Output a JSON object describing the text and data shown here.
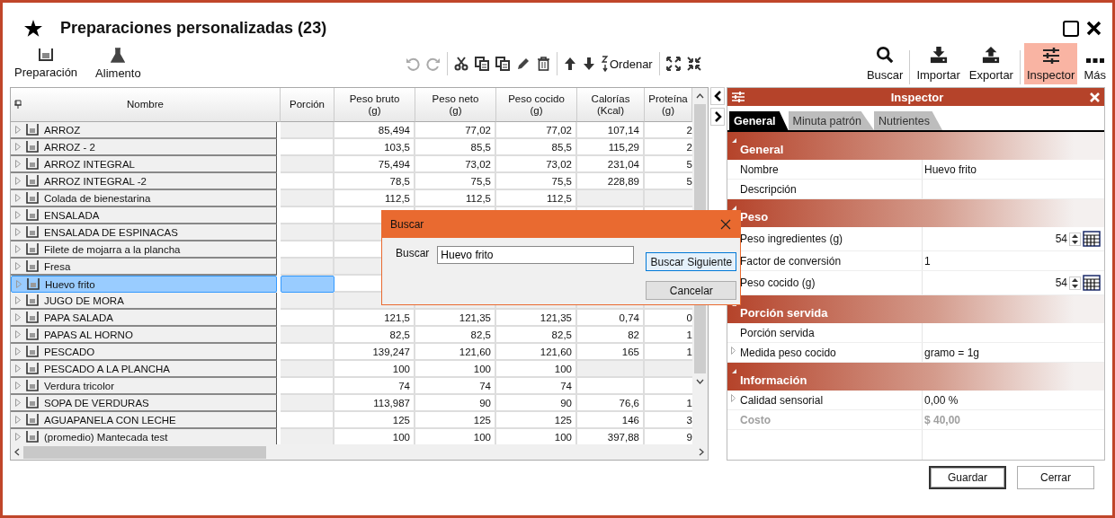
{
  "window": {
    "title": "Preparaciones personalizadas (23)"
  },
  "left_tools": [
    {
      "kind": "bowl",
      "label": "Preparación"
    },
    {
      "kind": "flask",
      "label": "Alimento"
    }
  ],
  "edit_tools": [
    {
      "kind": "undo",
      "disabled": true
    },
    {
      "kind": "redo",
      "disabled": true
    },
    {
      "kind": "sep"
    },
    {
      "kind": "cut"
    },
    {
      "kind": "copy"
    },
    {
      "kind": "paste"
    },
    {
      "kind": "edit"
    },
    {
      "kind": "delete"
    },
    {
      "kind": "sep"
    },
    {
      "kind": "up"
    },
    {
      "kind": "down"
    },
    {
      "kind": "sort",
      "label": "Ordenar"
    },
    {
      "kind": "sep"
    },
    {
      "kind": "expand"
    },
    {
      "kind": "collapse"
    }
  ],
  "right_tools": [
    {
      "kind": "search",
      "label": "Buscar",
      "selected": false
    },
    {
      "kind": "import",
      "label": "Importar",
      "selected": false
    },
    {
      "kind": "export",
      "label": "Exportar",
      "selected": false
    },
    {
      "kind": "inspector",
      "label": "Inspector",
      "selected": true
    },
    {
      "kind": "more",
      "label": "Más",
      "selected": false
    }
  ],
  "table": {
    "columns": [
      "Nombre",
      "Porción",
      "Peso bruto\n(g)",
      "Peso neto\n(g)",
      "Peso cocido\n(g)",
      "Calorías\n(Kcal)",
      "Proteína\n(g)"
    ],
    "rows": [
      {
        "selected": false,
        "cells": [
          "ARROZ",
          null,
          "85,494",
          "77,02",
          "77,02",
          "107,14",
          "2"
        ]
      },
      {
        "selected": false,
        "cells": [
          "ARROZ - 2",
          null,
          "103,5",
          "85,5",
          "85,5",
          "115,29",
          "2"
        ]
      },
      {
        "selected": false,
        "cells": [
          "ARROZ INTEGRAL",
          null,
          "75,494",
          "73,02",
          "73,02",
          "231,04",
          "5"
        ]
      },
      {
        "selected": false,
        "cells": [
          "ARROZ INTEGRAL -2",
          null,
          "78,5",
          "75,5",
          "75,5",
          "228,89",
          "5"
        ]
      },
      {
        "selected": false,
        "cells": [
          "Colada de bienestarina",
          null,
          "112,5",
          "112,5",
          "112,5",
          null,
          null
        ]
      },
      {
        "selected": false,
        "cells": [
          "ENSALADA",
          null,
          null,
          null,
          null,
          null,
          null
        ]
      },
      {
        "selected": false,
        "cells": [
          "ENSALADA DE ESPINACAS",
          null,
          null,
          null,
          null,
          null,
          null
        ]
      },
      {
        "selected": false,
        "cells": [
          "Filete de mojarra a la plancha",
          null,
          null,
          null,
          null,
          null,
          null
        ]
      },
      {
        "selected": false,
        "cells": [
          "Fresa",
          null,
          null,
          null,
          null,
          null,
          null
        ]
      },
      {
        "selected": true,
        "cells": [
          "Huevo frito",
          null,
          null,
          null,
          null,
          null,
          null
        ]
      },
      {
        "selected": false,
        "cells": [
          "JUGO DE MORA",
          null,
          null,
          null,
          null,
          null,
          null
        ]
      },
      {
        "selected": false,
        "cells": [
          "PAPA SALADA",
          null,
          "121,5",
          "121,35",
          "121,35",
          "0,74",
          "0"
        ]
      },
      {
        "selected": false,
        "cells": [
          "PAPAS AL HORNO",
          null,
          "82,5",
          "82,5",
          "82,5",
          "82",
          "1"
        ]
      },
      {
        "selected": false,
        "cells": [
          "PESCADO",
          null,
          "139,247",
          "121,60",
          "121,60",
          "165",
          "1"
        ]
      },
      {
        "selected": false,
        "cells": [
          "PESCADO A LA PLANCHA",
          null,
          "100",
          "100",
          "100",
          null,
          null
        ]
      },
      {
        "selected": false,
        "cells": [
          "Verdura tricolor",
          null,
          "74",
          "74",
          "74",
          null,
          null
        ]
      },
      {
        "selected": false,
        "cells": [
          "SOPA DE VERDURAS",
          null,
          "113,987",
          "90",
          "90",
          "76,6",
          "1"
        ]
      },
      {
        "selected": false,
        "cells": [
          "AGUAPANELA CON LECHE",
          null,
          "125",
          "125",
          "125",
          "146",
          "3"
        ]
      },
      {
        "selected": false,
        "cells": [
          "(promedio) Mantecada test",
          null,
          "100",
          "100",
          "100",
          "397,88",
          "9"
        ]
      }
    ]
  },
  "dialog": {
    "title": "Buscar",
    "label": "Buscar",
    "value": "Huevo frito",
    "buttons": [
      {
        "label": "Buscar Siguiente",
        "default": true
      },
      {
        "label": "Cancelar",
        "default": false
      }
    ]
  },
  "inspector": {
    "title": "Inspector",
    "tabs": [
      {
        "label": "General",
        "selected": true
      },
      {
        "label": "Minuta patrón",
        "selected": false
      },
      {
        "label": "Nutrientes",
        "selected": false
      }
    ],
    "categories": [
      {
        "title": "General",
        "properties": [
          {
            "kind": "text",
            "label": "Nombre",
            "value": "Huevo frito",
            "expandable": false,
            "disabled": false
          },
          {
            "kind": "text",
            "label": "Descripción",
            "expandable": false,
            "disabled": false
          }
        ]
      },
      {
        "title": "Peso",
        "properties": [
          {
            "kind": "spin",
            "label": "Peso ingredientes (g)",
            "value": "54",
            "disabled": false
          },
          {
            "kind": "text",
            "label": "Factor de conversión",
            "value": "1",
            "disabled": false
          },
          {
            "kind": "spin",
            "label": "Peso cocido (g)",
            "value": "54",
            "disabled": false
          }
        ]
      },
      {
        "title": "Porción servida",
        "properties": [
          {
            "kind": "text",
            "label": "Porción servida",
            "expandable": false,
            "disabled": false
          },
          {
            "kind": "text",
            "label": "Medida peso cocido",
            "value": "gramo = 1g",
            "expandable": true,
            "disabled": false
          }
        ]
      },
      {
        "title": "Información",
        "properties": [
          {
            "kind": "text",
            "label": "Calidad sensorial",
            "value": "0,00 %",
            "expandable": true,
            "disabled": false
          },
          {
            "kind": "text",
            "label": "Costo",
            "value": "$ 40,00",
            "expandable": false,
            "disabled": true
          }
        ]
      }
    ]
  },
  "footer_buttons": [
    {
      "label": "Guardar",
      "default": true
    },
    {
      "label": "Cerrar",
      "default": false
    }
  ]
}
